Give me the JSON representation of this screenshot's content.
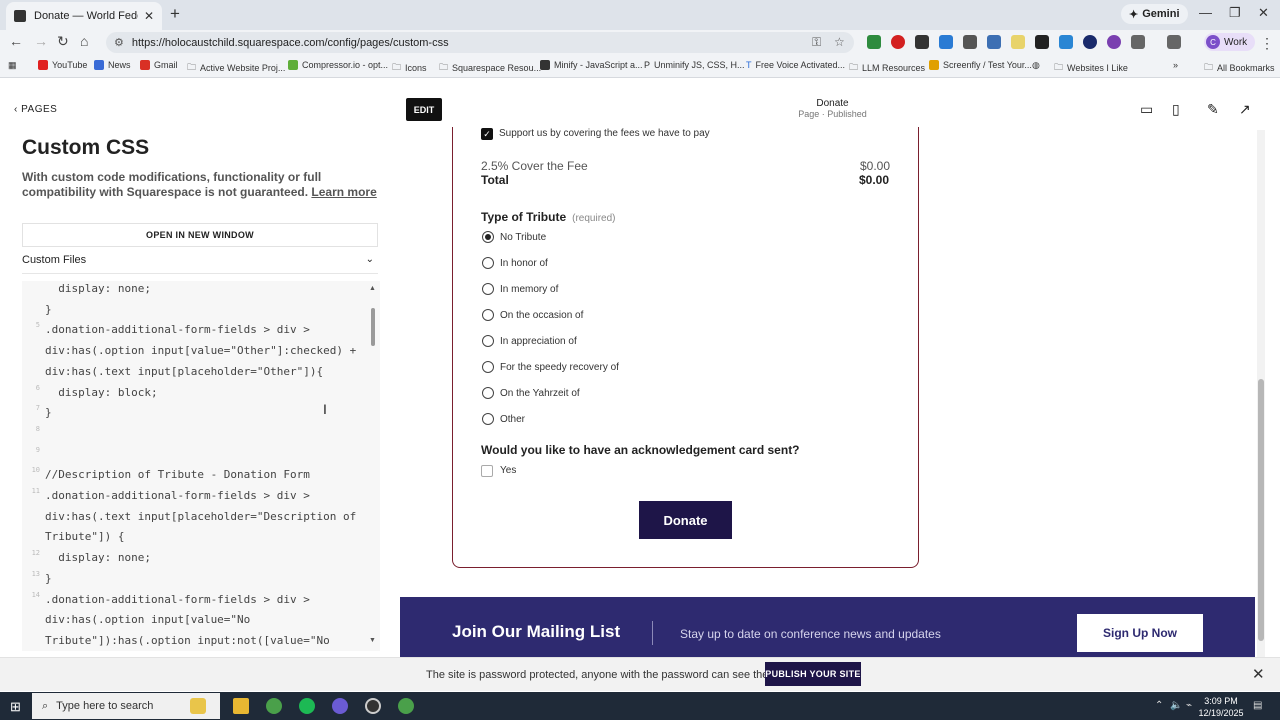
{
  "browser": {
    "tab_title": "Donate — World Federation of",
    "gemini_label": "Gemini",
    "url": "https://holocaustchild.squarespace.com/config/pages/custom-css",
    "profile_label": "Work",
    "profile_initial": "C",
    "all_bookmarks": "All Bookmarks",
    "bookmarks": [
      {
        "label": "YouTube",
        "color": "#e02020"
      },
      {
        "label": "News",
        "color": "#3a6bd6"
      },
      {
        "label": "Gmail",
        "color": "#d93025"
      },
      {
        "label": "Active Website Proj...",
        "color": "#555555"
      },
      {
        "label": "Compressor.io - opt...",
        "color": "#5fae3a"
      },
      {
        "label": "Icons",
        "color": "#555555"
      },
      {
        "label": "Squarespace Resou...",
        "color": "#555555"
      },
      {
        "label": "Minify - JavaScript a...",
        "color": "#333333"
      },
      {
        "label": "Unminify JS, CSS, H...",
        "color": "#333333"
      },
      {
        "label": "Free Voice Activated...",
        "color": "#2b6cd9"
      },
      {
        "label": "LLM Resources",
        "color": "#555555"
      },
      {
        "label": "Screenfly / Test Your...",
        "color": "#e0a000"
      },
      {
        "label": "Websites I Like",
        "color": "#555555"
      }
    ]
  },
  "sidebar": {
    "back_label": "PAGES",
    "title": "Custom CSS",
    "description": "With custom code modifications, functionality or full compatibility with Squarespace is not guaranteed.",
    "learn_more": "Learn more",
    "open_button": "OPEN IN NEW WINDOW",
    "files_label": "Custom Files"
  },
  "code": {
    "lines": [
      {
        "num": "",
        "text": "  display: none;"
      },
      {
        "num": "",
        "text": "}"
      },
      {
        "num": "5",
        "text": ".donation-additional-form-fields > div >"
      },
      {
        "num": "",
        "text": "div:has(.option input[value=\"Other\"]:checked) +"
      },
      {
        "num": "",
        "text": "div:has(.text input[placeholder=\"Other\"]){"
      },
      {
        "num": "6",
        "text": "  display: block;"
      },
      {
        "num": "7",
        "text": "}"
      },
      {
        "num": "8",
        "text": ""
      },
      {
        "num": "9",
        "text": ""
      },
      {
        "num": "10",
        "text": "//Description of Tribute - Donation Form"
      },
      {
        "num": "11",
        "text": ".donation-additional-form-fields > div >"
      },
      {
        "num": "",
        "text": "div:has(.text input[placeholder=\"Description of"
      },
      {
        "num": "",
        "text": "Tribute\"]) {"
      },
      {
        "num": "12",
        "text": "  display: none;"
      },
      {
        "num": "13",
        "text": "}"
      },
      {
        "num": "14",
        "text": ".donation-additional-form-fields > div >"
      },
      {
        "num": "",
        "text": "div:has(.option input[value=\"No"
      },
      {
        "num": "",
        "text": "Tribute\"]):has(.option input:not([value=\"No"
      }
    ]
  },
  "preview": {
    "edit_label": "EDIT",
    "page_title": "Donate",
    "page_status": "Page · Published",
    "cover_fee_label": "Support us by covering the fees we have to pay",
    "fee_label": "2.5% Cover the Fee",
    "fee_value": "$0.00",
    "total_label": "Total",
    "total_value": "$0.00",
    "tribute_heading": "Type of Tribute",
    "required_label": "(required)",
    "tribute_options": [
      {
        "label": "No Tribute",
        "checked": true
      },
      {
        "label": "In honor of",
        "checked": false
      },
      {
        "label": "In memory of",
        "checked": false
      },
      {
        "label": "On the occasion of",
        "checked": false
      },
      {
        "label": "In appreciation of",
        "checked": false
      },
      {
        "label": "For the speedy recovery of",
        "checked": false
      },
      {
        "label": "On the Yahrzeit of",
        "checked": false
      },
      {
        "label": "Other",
        "checked": false
      }
    ],
    "card_question": "Would you like to have an acknowledgement card sent?",
    "card_yes": "Yes",
    "donate_button": "Donate",
    "mailing_title": "Join Our Mailing List",
    "mailing_sub": "Stay up to date on conference news and updates",
    "signup_button": "Sign Up Now",
    "password_msg": "The site is password protected, anyone with the password can see the site.",
    "publish_button": "PUBLISH YOUR SITE"
  },
  "taskbar": {
    "search_placeholder": "Type here to search",
    "time": "3:09 PM",
    "date": "12/19/2025"
  },
  "colors": {
    "accent_navy": "#1e1548",
    "mailing_bg": "#2e2a70",
    "form_border": "#7a1f2e"
  }
}
